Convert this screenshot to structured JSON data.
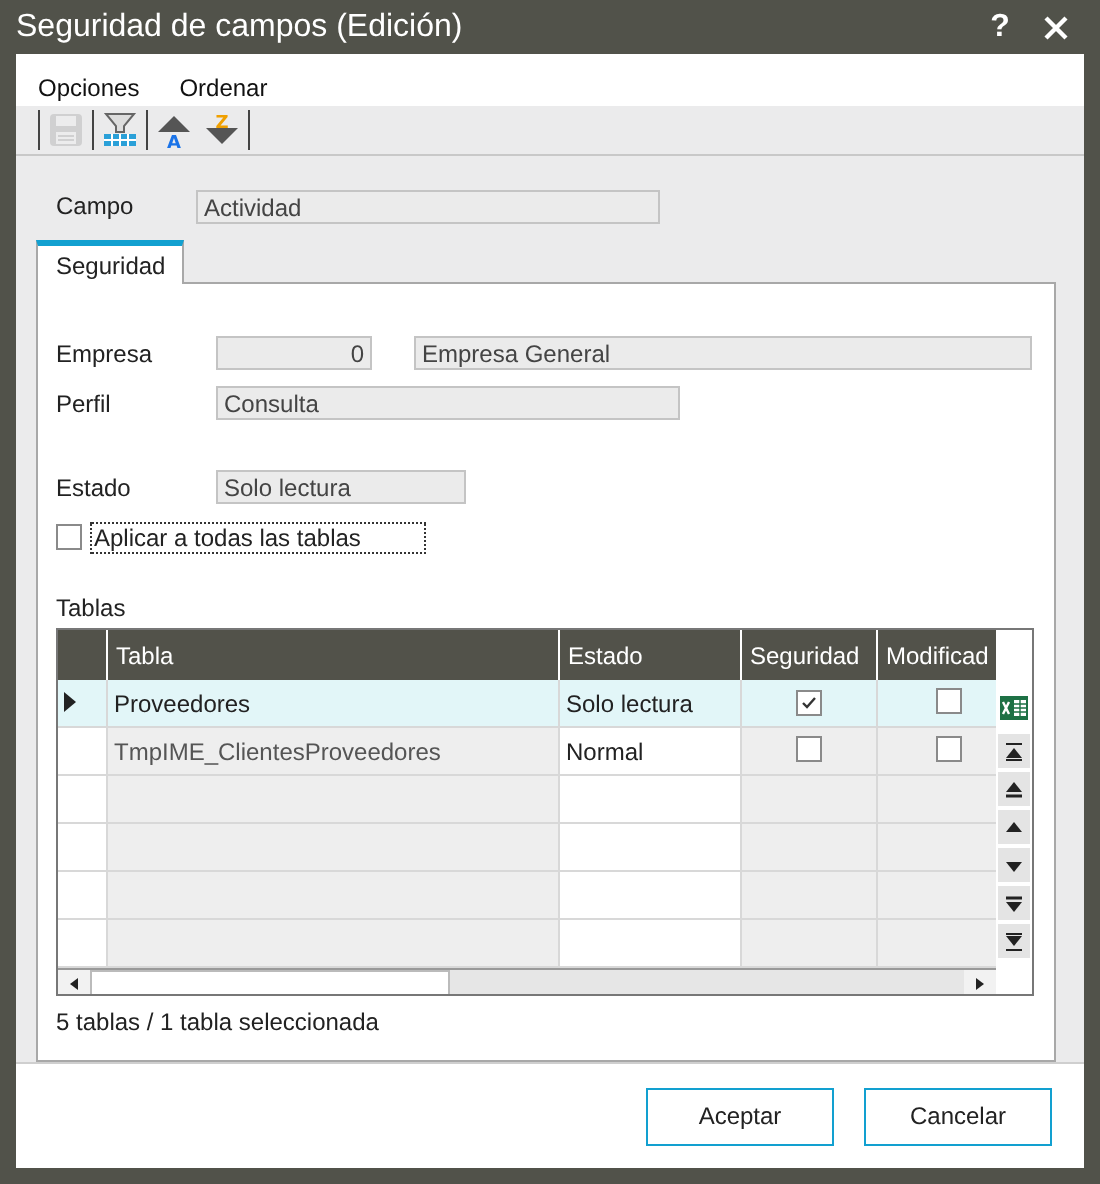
{
  "window": {
    "title": "Seguridad de campos (Edición)",
    "help": "?"
  },
  "menu": [
    "Opciones",
    "Ordenar"
  ],
  "toolbar": [
    {
      "kind": "save",
      "disabled": true
    },
    {
      "kind": "filter",
      "disabled": false
    },
    {
      "kind": "sort-asc",
      "disabled": false,
      "letter": "A"
    },
    {
      "kind": "sort-desc",
      "disabled": false,
      "letter": "Z"
    }
  ],
  "campo": {
    "label": "Campo",
    "value": "Actividad"
  },
  "tabs": [
    {
      "label": "Seguridad",
      "selected": true
    }
  ],
  "empresa": {
    "label": "Empresa",
    "code": "0",
    "name": "Empresa General"
  },
  "perfil": {
    "label": "Perfil",
    "value": "Consulta"
  },
  "estado": {
    "label": "Estado",
    "value": "Solo lectura"
  },
  "apply_all": {
    "label": "Aplicar a todas las tablas",
    "checked": false
  },
  "tables": {
    "label": "Tablas",
    "columns": [
      "Tabla",
      "Estado",
      "Seguridad",
      "Modificad"
    ],
    "rows": [
      {
        "tabla": "Proveedores",
        "estado": "Solo lectura",
        "seguridad": true,
        "modificado": false,
        "selected": true
      },
      {
        "tabla": "TmpIME_ClientesProveedores",
        "estado": "Normal",
        "seguridad": false,
        "modificado": false,
        "selected": false
      }
    ]
  },
  "status": "5 tablas / 1 tabla seleccionada",
  "buttons": [
    "Aceptar",
    "Cancelar"
  ]
}
